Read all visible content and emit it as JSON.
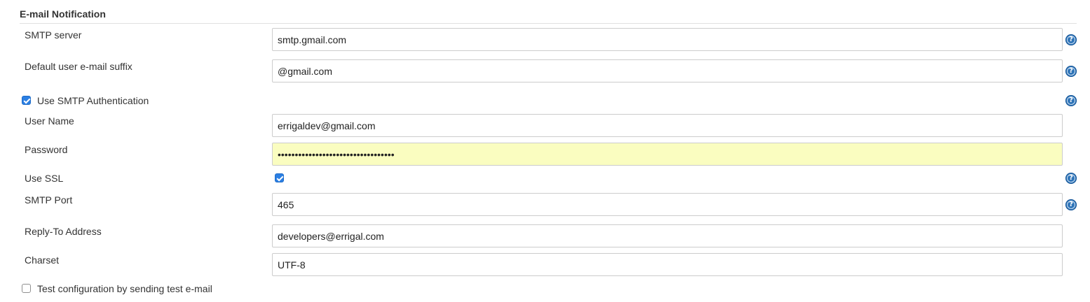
{
  "section": {
    "title": "E-mail Notification"
  },
  "fields": {
    "smtp_server": {
      "label": "SMTP server",
      "value": "smtp.gmail.com"
    },
    "email_suffix": {
      "label": "Default user e-mail suffix",
      "value": "@gmail.com"
    },
    "use_smtp_auth": {
      "label": "Use SMTP Authentication",
      "checked": true
    },
    "user_name": {
      "label": "User Name",
      "value": "errigaldev@gmail.com"
    },
    "password": {
      "label": "Password",
      "value": "••••••••••••••••••••••••••••••••••"
    },
    "use_ssl": {
      "label": "Use SSL",
      "checked": true
    },
    "smtp_port": {
      "label": "SMTP Port",
      "value": "465"
    },
    "reply_to": {
      "label": "Reply-To Address",
      "value": "developers@errigal.com"
    },
    "charset": {
      "label": "Charset",
      "value": "UTF-8"
    },
    "test_config": {
      "label": "Test configuration by sending test e-mail",
      "checked": false
    }
  },
  "icons": {
    "help": {
      "glyph": "?",
      "name": "help-icon",
      "color": "#2e74b8"
    },
    "checkmark": "checkbox-checked-icon"
  },
  "colors": {
    "password_bg": "#fafdc0",
    "checkbox_checked": "#2b7fe3",
    "field_border": "#cccccc"
  }
}
